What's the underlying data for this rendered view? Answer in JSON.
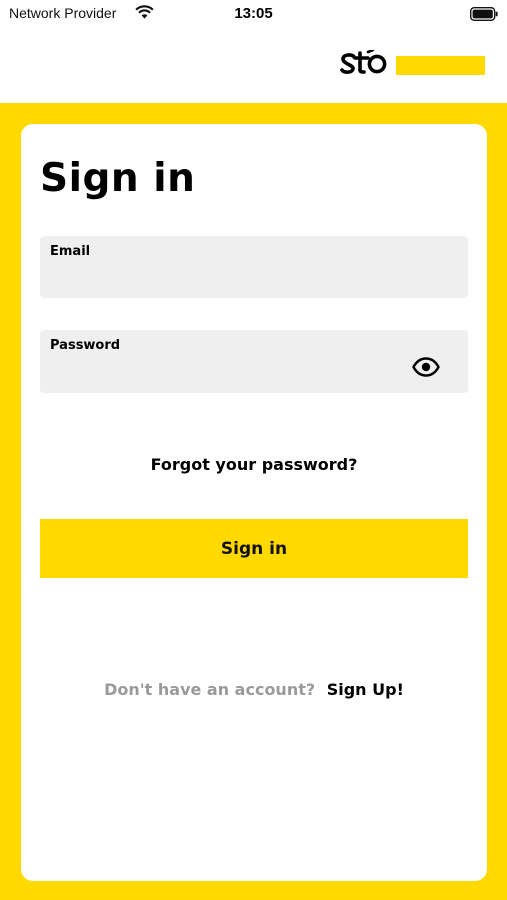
{
  "status_bar": {
    "carrier": "Network Provider",
    "time": "13:05"
  },
  "header": {
    "logo_icon": "sto-logo-icon",
    "brand_color": "#FFD900"
  },
  "signin": {
    "title": "Sign in",
    "email_label": "Email",
    "email_value": "",
    "password_label": "Password",
    "password_value": "",
    "password_toggle_icon": "eye-icon",
    "forgot_password": "Forgot your password?",
    "submit_label": "Sign in",
    "signup_prompt": "Don't have an account?",
    "signup_link": "Sign Up!"
  }
}
